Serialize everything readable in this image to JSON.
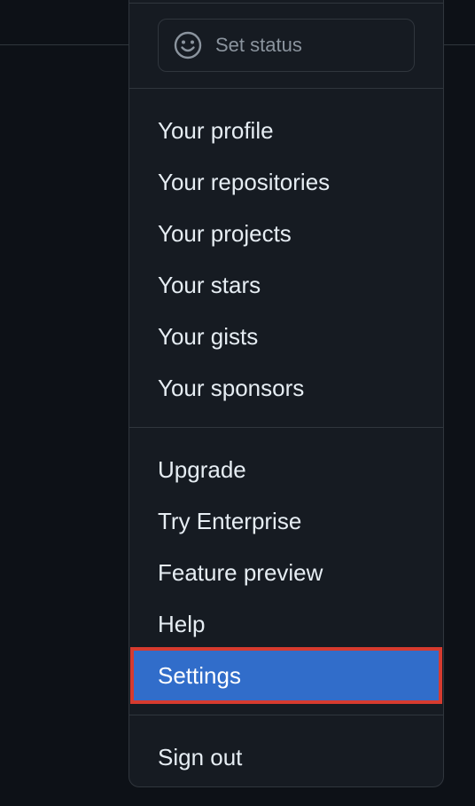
{
  "status_button": {
    "label": "Set status",
    "icon": "smiley-icon"
  },
  "menu": {
    "group_profile": [
      "Your profile",
      "Your repositories",
      "Your projects",
      "Your stars",
      "Your gists",
      "Your sponsors"
    ],
    "group_account": [
      "Upgrade",
      "Try Enterprise",
      "Feature preview",
      "Help",
      "Settings"
    ],
    "group_signout": [
      "Sign out"
    ],
    "selected_item": "Settings"
  },
  "colors": {
    "page_background": "#0d1117",
    "menu_background": "#161b22",
    "border": "#30363d",
    "text": "#e6edf3",
    "muted_text": "#8b949e",
    "selected_background": "#316dca",
    "highlight_outline": "#d63b2f"
  }
}
